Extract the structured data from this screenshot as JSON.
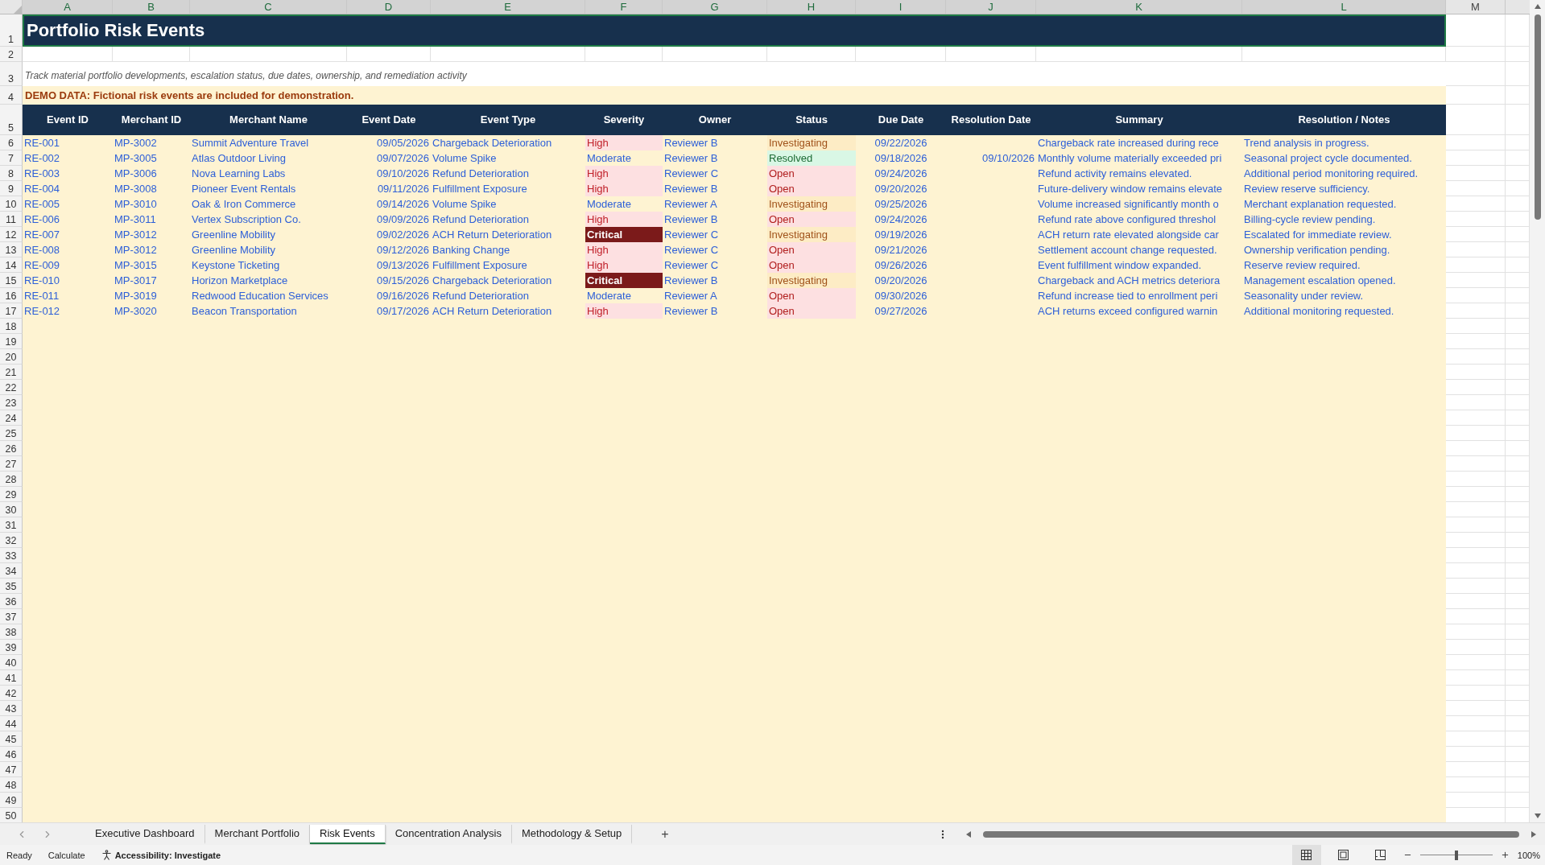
{
  "column_letters": [
    {
      "label": "A",
      "selected": true
    },
    {
      "label": "B",
      "selected": true
    },
    {
      "label": "C",
      "selected": true
    },
    {
      "label": "D",
      "selected": true
    },
    {
      "label": "E",
      "selected": true
    },
    {
      "label": "F",
      "selected": true
    },
    {
      "label": "G",
      "selected": true
    },
    {
      "label": "H",
      "selected": true
    },
    {
      "label": "I",
      "selected": true
    },
    {
      "label": "J",
      "selected": true
    },
    {
      "label": "K",
      "selected": true
    },
    {
      "label": "L",
      "selected": true
    },
    {
      "label": "M",
      "selected": false
    }
  ],
  "row_numbers": [
    "1",
    "2",
    "3",
    "4",
    "5",
    "6",
    "7",
    "8",
    "9",
    "10",
    "11",
    "12",
    "13",
    "14",
    "15",
    "16",
    "17",
    "18",
    "19",
    "20",
    "21",
    "22",
    "23",
    "24",
    "25",
    "26",
    "27",
    "28",
    "29",
    "30",
    "31",
    "32",
    "33",
    "34",
    "35",
    "36",
    "37",
    "38",
    "39",
    "40",
    "41",
    "42",
    "43",
    "44",
    "45",
    "46",
    "47",
    "48",
    "49",
    "50"
  ],
  "title": "Portfolio Risk Events",
  "subtitle": "Track material portfolio developments, escalation status, due dates, ownership, and remediation activity",
  "demo_notice": "DEMO DATA: Fictional risk events are included for demonstration.",
  "table": {
    "columns": [
      "Event ID",
      "Merchant ID",
      "Merchant Name",
      "Event Date",
      "Event Type",
      "Severity",
      "Owner",
      "Status",
      "Due Date",
      "Resolution Date",
      "Summary",
      "Resolution / Notes"
    ],
    "rows": [
      {
        "event_id": "RE-001",
        "merchant_id": "MP-3002",
        "merchant_name": "Summit Adventure Travel",
        "event_date": "09/05/2026",
        "event_type": "Chargeback Deterioration",
        "severity": {
          "text": "High",
          "kind": "high"
        },
        "owner": "Reviewer B",
        "status": {
          "text": "Investigating",
          "kind": "investigating"
        },
        "due_date": "09/22/2026",
        "summary": "Chargeback rate increased during rece",
        "notes": "Trend analysis in progress."
      },
      {
        "event_id": "RE-002",
        "merchant_id": "MP-3005",
        "merchant_name": "Atlas Outdoor Living",
        "event_date": "09/07/2026",
        "event_type": "Volume Spike",
        "severity": {
          "text": "Moderate",
          "kind": "moderate"
        },
        "owner": "Reviewer B",
        "status": {
          "text": "Resolved",
          "kind": "resolved"
        },
        "due_date": "09/18/2026",
        "resolution_date": "09/10/2026",
        "summary": "Monthly volume materially exceeded pri",
        "notes": "Seasonal project cycle documented."
      },
      {
        "event_id": "RE-003",
        "merchant_id": "MP-3006",
        "merchant_name": "Nova Learning Labs",
        "event_date": "09/10/2026",
        "event_type": "Refund Deterioration",
        "severity": {
          "text": "High",
          "kind": "high"
        },
        "owner": "Reviewer C",
        "status": {
          "text": "Open",
          "kind": "open"
        },
        "due_date": "09/24/2026",
        "summary": "Refund activity remains elevated.",
        "notes": "Additional period monitoring required."
      },
      {
        "event_id": "RE-004",
        "merchant_id": "MP-3008",
        "merchant_name": "Pioneer Event Rentals",
        "event_date": "09/11/2026",
        "event_type": "Fulfillment Exposure",
        "severity": {
          "text": "High",
          "kind": "high"
        },
        "owner": "Reviewer B",
        "status": {
          "text": "Open",
          "kind": "open"
        },
        "due_date": "09/20/2026",
        "summary": "Future-delivery window remains elevate",
        "notes": "Review reserve sufficiency."
      },
      {
        "event_id": "RE-005",
        "merchant_id": "MP-3010",
        "merchant_name": "Oak & Iron Commerce",
        "event_date": "09/14/2026",
        "event_type": "Volume Spike",
        "severity": {
          "text": "Moderate",
          "kind": "moderate"
        },
        "owner": "Reviewer A",
        "status": {
          "text": "Investigating",
          "kind": "investigating"
        },
        "due_date": "09/25/2026",
        "summary": "Volume increased significantly month o",
        "notes": "Merchant explanation requested."
      },
      {
        "event_id": "RE-006",
        "merchant_id": "MP-3011",
        "merchant_name": "Vertex Subscription Co.",
        "event_date": "09/09/2026",
        "event_type": "Refund Deterioration",
        "severity": {
          "text": "High",
          "kind": "high"
        },
        "owner": "Reviewer B",
        "status": {
          "text": "Open",
          "kind": "open"
        },
        "due_date": "09/24/2026",
        "summary": "Refund rate above configured threshol",
        "notes": "Billing-cycle review pending."
      },
      {
        "event_id": "RE-007",
        "merchant_id": "MP-3012",
        "merchant_name": "Greenline Mobility",
        "event_date": "09/02/2026",
        "event_type": "ACH Return Deterioration",
        "severity": {
          "text": "Critical",
          "kind": "critical"
        },
        "owner": "Reviewer C",
        "status": {
          "text": "Investigating",
          "kind": "investigating"
        },
        "due_date": "09/19/2026",
        "summary": "ACH return rate elevated alongside car",
        "notes": "Escalated for immediate review."
      },
      {
        "event_id": "RE-008",
        "merchant_id": "MP-3012",
        "merchant_name": "Greenline Mobility",
        "event_date": "09/12/2026",
        "event_type": "Banking Change",
        "severity": {
          "text": "High",
          "kind": "high"
        },
        "owner": "Reviewer C",
        "status": {
          "text": "Open",
          "kind": "open"
        },
        "due_date": "09/21/2026",
        "summary": "Settlement account change requested.",
        "notes": "Ownership verification pending."
      },
      {
        "event_id": "RE-009",
        "merchant_id": "MP-3015",
        "merchant_name": "Keystone Ticketing",
        "event_date": "09/13/2026",
        "event_type": "Fulfillment Exposure",
        "severity": {
          "text": "High",
          "kind": "high"
        },
        "owner": "Reviewer C",
        "status": {
          "text": "Open",
          "kind": "open"
        },
        "due_date": "09/26/2026",
        "summary": "Event fulfillment window expanded.",
        "notes": "Reserve review required."
      },
      {
        "event_id": "RE-010",
        "merchant_id": "MP-3017",
        "merchant_name": "Horizon Marketplace",
        "event_date": "09/15/2026",
        "event_type": "Chargeback Deterioration",
        "severity": {
          "text": "Critical",
          "kind": "critical"
        },
        "owner": "Reviewer B",
        "status": {
          "text": "Investigating",
          "kind": "investigating"
        },
        "due_date": "09/20/2026",
        "summary": "Chargeback and ACH metrics deteriora",
        "notes": "Management escalation opened."
      },
      {
        "event_id": "RE-011",
        "merchant_id": "MP-3019",
        "merchant_name": "Redwood Education Services",
        "event_date": "09/16/2026",
        "event_type": "Refund Deterioration",
        "severity": {
          "text": "Moderate",
          "kind": "moderate"
        },
        "owner": "Reviewer A",
        "status": {
          "text": "Open",
          "kind": "open"
        },
        "due_date": "09/30/2026",
        "summary": "Refund increase tied to enrollment peri",
        "notes": "Seasonality under review."
      },
      {
        "event_id": "RE-012",
        "merchant_id": "MP-3020",
        "merchant_name": "Beacon Transportation",
        "event_date": "09/17/2026",
        "event_type": "ACH Return Deterioration",
        "severity": {
          "text": "High",
          "kind": "high"
        },
        "owner": "Reviewer B",
        "status": {
          "text": "Open",
          "kind": "open"
        },
        "due_date": "09/27/2026",
        "summary": "ACH returns exceed configured warnin",
        "notes": "Additional monitoring requested."
      }
    ]
  },
  "sheet_tabs": [
    {
      "label": "Executive Dashboard",
      "selected": false
    },
    {
      "label": "Merchant Portfolio",
      "selected": false
    },
    {
      "label": "Risk Events",
      "selected": true
    },
    {
      "label": "Concentration Analysis",
      "selected": false
    },
    {
      "label": "Methodology & Setup",
      "selected": false
    }
  ],
  "add_sheet": "+",
  "status_bar": {
    "ready": "Ready",
    "calculate": "Calculate",
    "accessibility": "Accessibility: Investigate",
    "zoom": {
      "level": 0.5,
      "reading": "100%"
    }
  }
}
